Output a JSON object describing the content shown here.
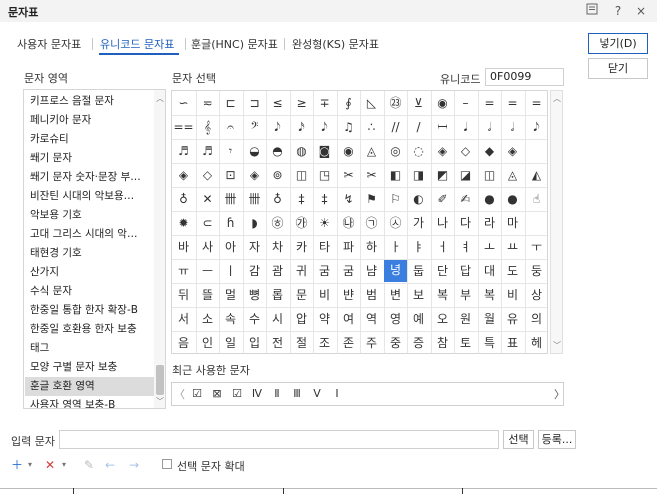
{
  "window": {
    "title": "문자표",
    "icons": [
      "window-menu-icon",
      "help-icon",
      "close-icon"
    ],
    "help_glyph": "?",
    "close_glyph": "×"
  },
  "tabs": [
    {
      "label": "사용자 문자표",
      "active": false
    },
    {
      "label": "유니코드 문자표",
      "active": true
    },
    {
      "label": "훈글(HNC) 문자표",
      "active": false
    },
    {
      "label": "완성형(KS) 문자표",
      "active": false
    }
  ],
  "buttons": {
    "insert": "넣기(D)",
    "close": "닫기",
    "select": "선택",
    "register": "등록..."
  },
  "region": {
    "label": "문자 영역",
    "items": [
      "키프로스 음절 문자",
      "페니키아 문자",
      "카로슈티",
      "쐐기 문자",
      "쐐기 문자 숫자·문장 부…",
      "비잔틴 시대의 악보용…",
      "악보용 기호",
      "고대 그리스 시대의 악…",
      "태현경 기호",
      "산가지",
      "수식 문자",
      "한중일 통합 한자 확장-B",
      "한중일 호환용 한자 보충",
      "태그",
      "모양 구별 문자 보충",
      "훈글 호환 영역",
      "사용자 영역 보충-B"
    ],
    "selected_index": 15
  },
  "char_select": {
    "label": "문자 선택",
    "unicode_label": "유니코드",
    "unicode_value": "0F0099",
    "selected_cell": [
      7,
      9
    ],
    "rows": [
      [
        "∽",
        "≂",
        "⊏",
        "⊐",
        "≤",
        "≥",
        "∓",
        "∮",
        "◺",
        "㉓",
        "⊻",
        "◉",
        "–",
        "=",
        "=",
        "="
      ],
      [
        "==",
        "𝄞",
        "𝄐",
        "𝄢",
        "𝅘𝅥𝅮",
        "𝅘𝅥𝅯",
        "𝅘𝅥𝅮",
        "♫",
        "∴",
        "//",
        "/",
        "𝄩",
        "𝅘𝅥",
        "𝅗𝅥",
        "𝅗𝅥",
        "𝅘𝅥𝅮"
      ],
      [
        "♬",
        "♬",
        "𝄾",
        "◒",
        "◓",
        "◍",
        "◙",
        "◉",
        "◬",
        "◎",
        "◌",
        "◈",
        "◇",
        "◆",
        "◈",
        ""
      ],
      [
        "◈",
        "◇",
        "⊡",
        "◈",
        "⊚",
        "◫",
        "◳",
        "✂",
        "✂",
        "◧",
        "◨",
        "◩",
        "◪",
        "◫",
        "◬",
        "◭"
      ],
      [
        "♁",
        "✕",
        "卌",
        "卌",
        "♁",
        "‡",
        "‡",
        "↯",
        "⚑",
        "⚐",
        "◐",
        "✐",
        "✍",
        "●",
        "●",
        "☝"
      ],
      [
        "✹",
        "⊂",
        "ɦ",
        "◗",
        "㉭",
        "㉮",
        "☀",
        "㉯",
        "㉠",
        "㉦",
        "가",
        "나",
        "다",
        "라",
        "마",
        ""
      ],
      [
        "바",
        "사",
        "아",
        "자",
        "차",
        "카",
        "타",
        "파",
        "하",
        "ㅏ",
        "ㅑ",
        "ㅓ",
        "ㅕ",
        "ㅗ",
        "ㅛ",
        "ㅜ"
      ],
      [
        "ㅠ",
        "ㅡ",
        "ㅣ",
        "감",
        "괌",
        "귀",
        "굼",
        "굼",
        "냠",
        "녕",
        "둡",
        "단",
        "답",
        "대",
        "도",
        "둥"
      ],
      [
        "뒤",
        "뜰",
        "멀",
        "뼝",
        "롭",
        "문",
        "비",
        "뱐",
        "범",
        "변",
        "보",
        "복",
        "부",
        "복",
        "비",
        "상"
      ],
      [
        "서",
        "소",
        "속",
        "수",
        "시",
        "압",
        "약",
        "여",
        "역",
        "영",
        "예",
        "오",
        "원",
        "월",
        "유",
        "의"
      ],
      [
        "음",
        "인",
        "일",
        "입",
        "전",
        "절",
        "조",
        "존",
        "주",
        "중",
        "증",
        "참",
        "토",
        "특",
        "표",
        "헤"
      ]
    ]
  },
  "recent": {
    "label": "최근 사용한 문자",
    "chars": [
      "☑",
      "⊠",
      "☑",
      "Ⅳ",
      "Ⅱ",
      "Ⅲ",
      "Ⅴ",
      "Ⅰ"
    ]
  },
  "input": {
    "label": "입력 문자",
    "value": ""
  },
  "toolbar": {
    "enlarge_label": "선택 문자 확대"
  }
}
